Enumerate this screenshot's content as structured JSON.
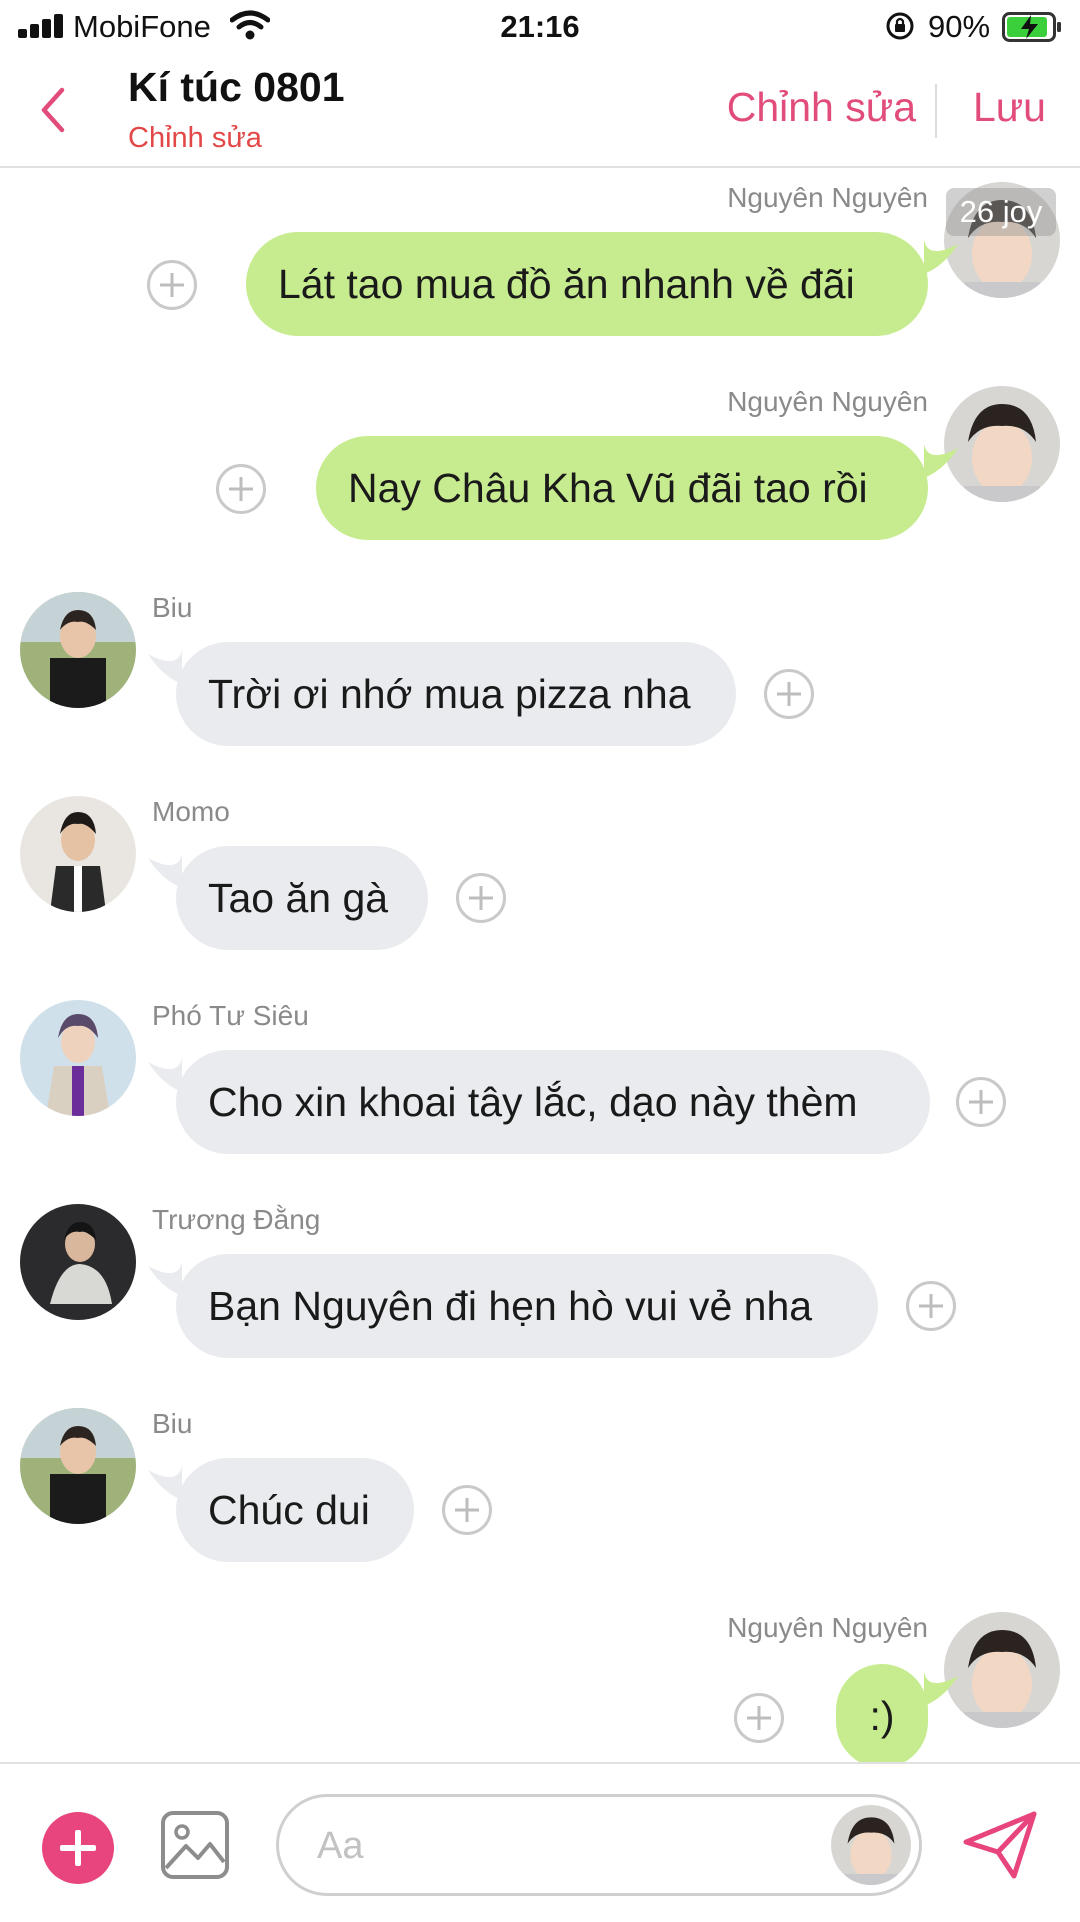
{
  "status_bar": {
    "carrier": "MobiFone",
    "time": "21:16",
    "battery": "90%",
    "icons": [
      "signal-icon",
      "wifi-icon",
      "orientation-lock-icon",
      "battery-charging-icon"
    ]
  },
  "header": {
    "title": "Kí túc 0801",
    "subtitle": "Chỉnh sửa",
    "edit_label": "Chỉnh sửa",
    "save_label": "Lưu",
    "accent_color": "#e24c7a"
  },
  "watermark": "26 joy",
  "messages": [
    {
      "sender": "Nguyên Nguyên",
      "text": "Lát tao mua đồ ăn nhanh về đãi",
      "side": "right"
    },
    {
      "sender": "Nguyên Nguyên",
      "text": "Nay Châu Kha Vũ đãi tao rồi",
      "side": "right"
    },
    {
      "sender": "Biu",
      "text": "Trời ơi nhớ mua pizza nha",
      "side": "left"
    },
    {
      "sender": "Momo",
      "text": "Tao ăn gà",
      "side": "left"
    },
    {
      "sender": "Phó Tư Siêu",
      "text": "Cho xin khoai tây lắc, dạo này thèm",
      "side": "left"
    },
    {
      "sender": "Trương Đằng",
      "text": "Bạn Nguyên đi hẹn hò vui vẻ nha",
      "side": "left"
    },
    {
      "sender": "Biu",
      "text": "Chúc dui",
      "side": "left"
    },
    {
      "sender": "Nguyên Nguyên",
      "text": ":)",
      "side": "right"
    }
  ],
  "composer": {
    "placeholder": "Aa"
  },
  "colors": {
    "outgoing_bubble": "#c7ec8f",
    "incoming_bubble": "#e9ebee",
    "add_button": "#e8457e"
  }
}
